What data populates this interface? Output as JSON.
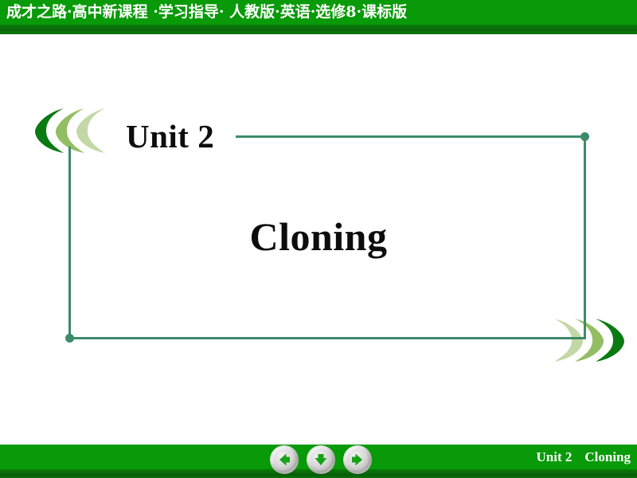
{
  "header": {
    "title": "成才之路·高中新课程 ·学习指导· 人教版·英语·选修8·课标版",
    "bg_color": "#089a08",
    "text_color": "#ffffff"
  },
  "slide": {
    "unit_label": "Unit 2",
    "lesson_title": "Cloning",
    "background": "#ffffff",
    "frame_color": "#3d8b6a",
    "decor": {
      "left_crescents_colors": [
        "#0a7a12",
        "#93bd63",
        "#c3d8a6"
      ],
      "right_crescents_colors": [
        "#c3d8a6",
        "#93bd63",
        "#0a7a12"
      ]
    }
  },
  "footer": {
    "unit_label": "Unit 2",
    "lesson_label": "Cloning",
    "bg_color": "#089a08",
    "text_color": "#ffffff"
  },
  "nav": {
    "buttons": [
      {
        "name": "previous-slide-button",
        "icon": "arrow-left-icon",
        "label": "Previous"
      },
      {
        "name": "down-slide-button",
        "icon": "arrow-down-icon",
        "label": "Down"
      },
      {
        "name": "next-slide-button",
        "icon": "arrow-right-icon",
        "label": "Next"
      }
    ],
    "arrow_color": "#18a018",
    "rim_color": "#d9d9d9"
  }
}
